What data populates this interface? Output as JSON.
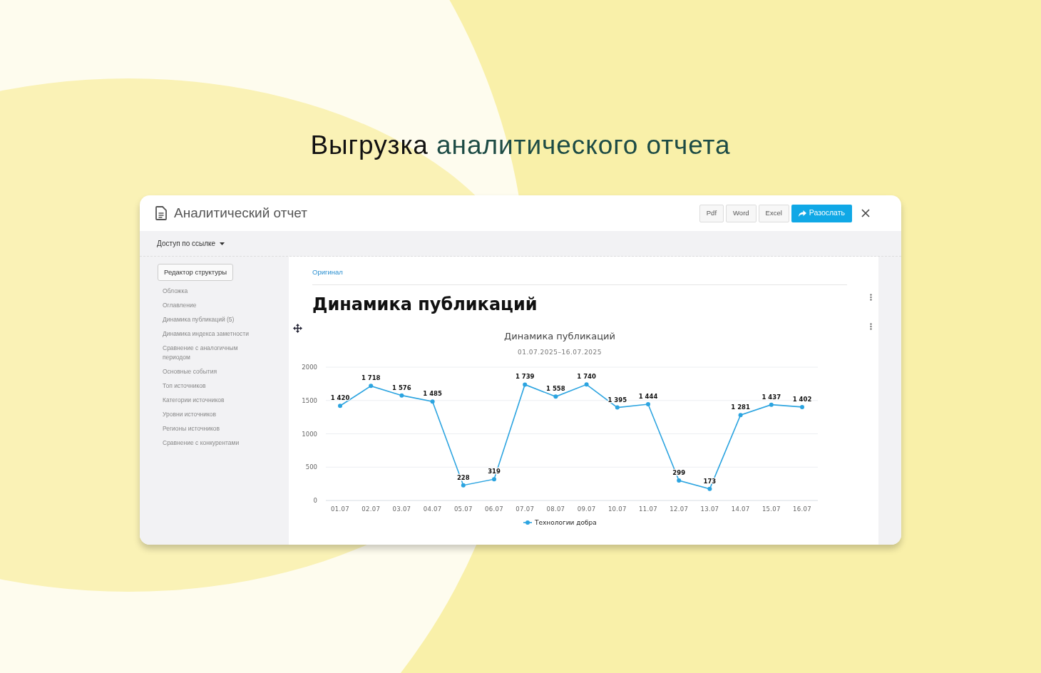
{
  "headline": {
    "lead": "Выгрузка",
    "rest": "аналитического отчета"
  },
  "window": {
    "title": "Аналитический отчет",
    "buttons": [
      {
        "label": "Pdf",
        "kind": "plain"
      },
      {
        "label": "Word",
        "kind": "plain"
      },
      {
        "label": "Excel",
        "kind": "plain"
      },
      {
        "label": "Разослать",
        "kind": "primary"
      }
    ]
  },
  "toolbar": {
    "access": "Доступ по ссылке"
  },
  "sidebar": {
    "editor_button": "Редактор структуры",
    "items": [
      "Обложка",
      "Оглавление",
      "Динамика публикаций (5)",
      "Динамика индекса заметности",
      "Сравнение с аналогичным периодом",
      "Основные события",
      "Топ источников",
      "Категории источников",
      "Уровни источников",
      "Регионы источников",
      "Сравнение с конкурентами"
    ]
  },
  "content": {
    "link": "Оригинал",
    "heading": "Динамика публикаций",
    "chart_data": {
      "type": "line",
      "title": "Динамика публикаций",
      "subtitle": "01.07.2025–16.07.2025",
      "categories": [
        "01.07",
        "02.07",
        "03.07",
        "04.07",
        "05.07",
        "06.07",
        "07.07",
        "08.07",
        "09.07",
        "10.07",
        "11.07",
        "12.07",
        "13.07",
        "14.07",
        "15.07",
        "16.07"
      ],
      "series": [
        {
          "name": "Технологии добра",
          "color": "#2ca4e0",
          "marker": "circle",
          "values": [
            1420,
            1718,
            1576,
            1485,
            228,
            319,
            1739,
            1558,
            1740,
            1395,
            1444,
            299,
            173,
            1281,
            1437,
            1402
          ]
        }
      ],
      "ylim": [
        0,
        2000
      ],
      "yticks": [
        0,
        500,
        1000,
        1500,
        2000
      ],
      "grid": true,
      "data_labels": true
    }
  }
}
